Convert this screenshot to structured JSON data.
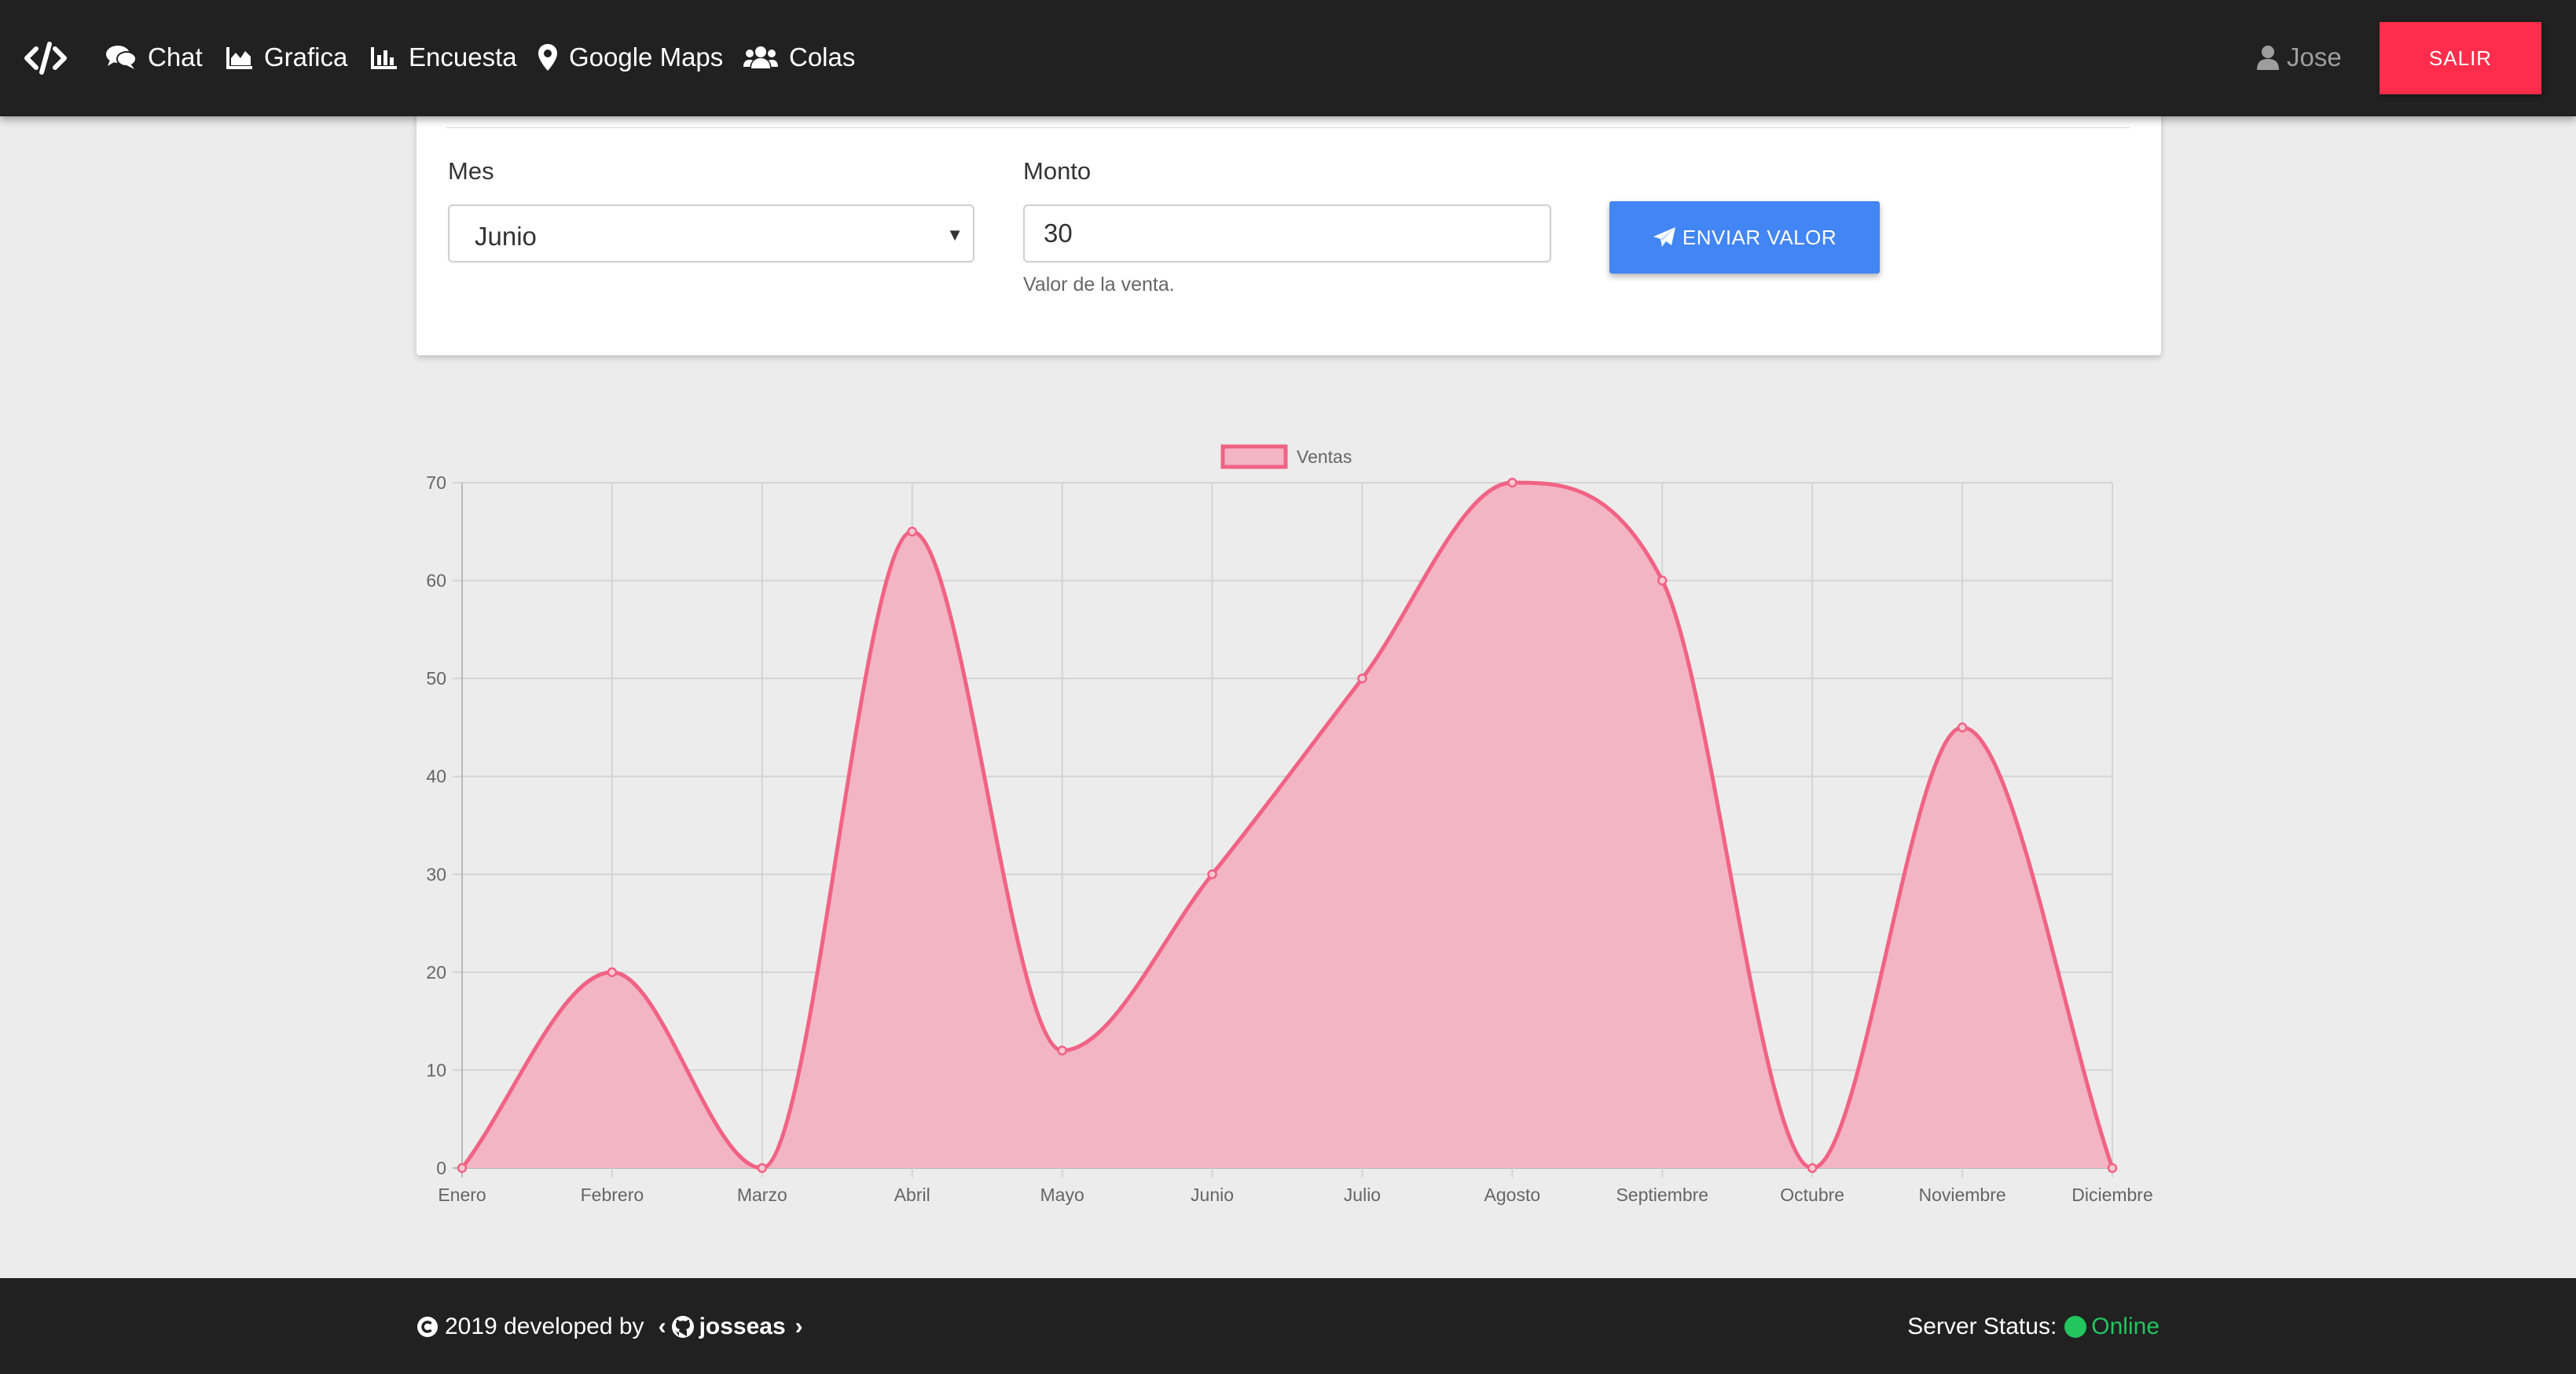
{
  "navbar": {
    "brand_icon": "code-icon",
    "links": [
      {
        "label": "Chat",
        "icon": "comments-icon"
      },
      {
        "label": "Grafica",
        "icon": "area-chart-icon"
      },
      {
        "label": "Encuesta",
        "icon": "bar-chart-icon"
      },
      {
        "label": "Google Maps",
        "icon": "map-marker-icon"
      },
      {
        "label": "Colas",
        "icon": "users-icon"
      }
    ],
    "user": {
      "name": "Jose",
      "icon": "user-icon"
    },
    "logout_label": "SALIR"
  },
  "form": {
    "mes_label": "Mes",
    "mes_value": "Junio",
    "monto_label": "Monto",
    "monto_value": "30",
    "monto_help": "Valor de la venta.",
    "submit_label": "ENVIAR VALOR",
    "submit_icon": "paper-plane-icon"
  },
  "chart_data": {
    "type": "line",
    "fill": true,
    "smooth": true,
    "categories": [
      "Enero",
      "Febrero",
      "Marzo",
      "Abril",
      "Mayo",
      "Junio",
      "Julio",
      "Agosto",
      "Septiembre",
      "Octubre",
      "Noviembre",
      "Diciembre"
    ],
    "series": [
      {
        "name": "Ventas",
        "values": [
          0,
          20,
          0,
          65,
          12,
          30,
          50,
          70,
          60,
          0,
          45,
          0
        ]
      }
    ],
    "yticks": [
      0,
      10,
      20,
      30,
      40,
      50,
      60,
      70
    ],
    "ylim": [
      0,
      70
    ],
    "grid": true,
    "legend": "top-center",
    "colors": {
      "line": "#f06384",
      "fill": "#f3b4c3"
    }
  },
  "footer": {
    "copyright": "2019 developed by",
    "github_user": "josseas",
    "status_label": "Server Status:",
    "status_value": "Online",
    "status_color": "#22c55e"
  },
  "colors": {
    "navbar": "#212121",
    "danger": "#ff2d4b",
    "primary": "#4285f4"
  }
}
